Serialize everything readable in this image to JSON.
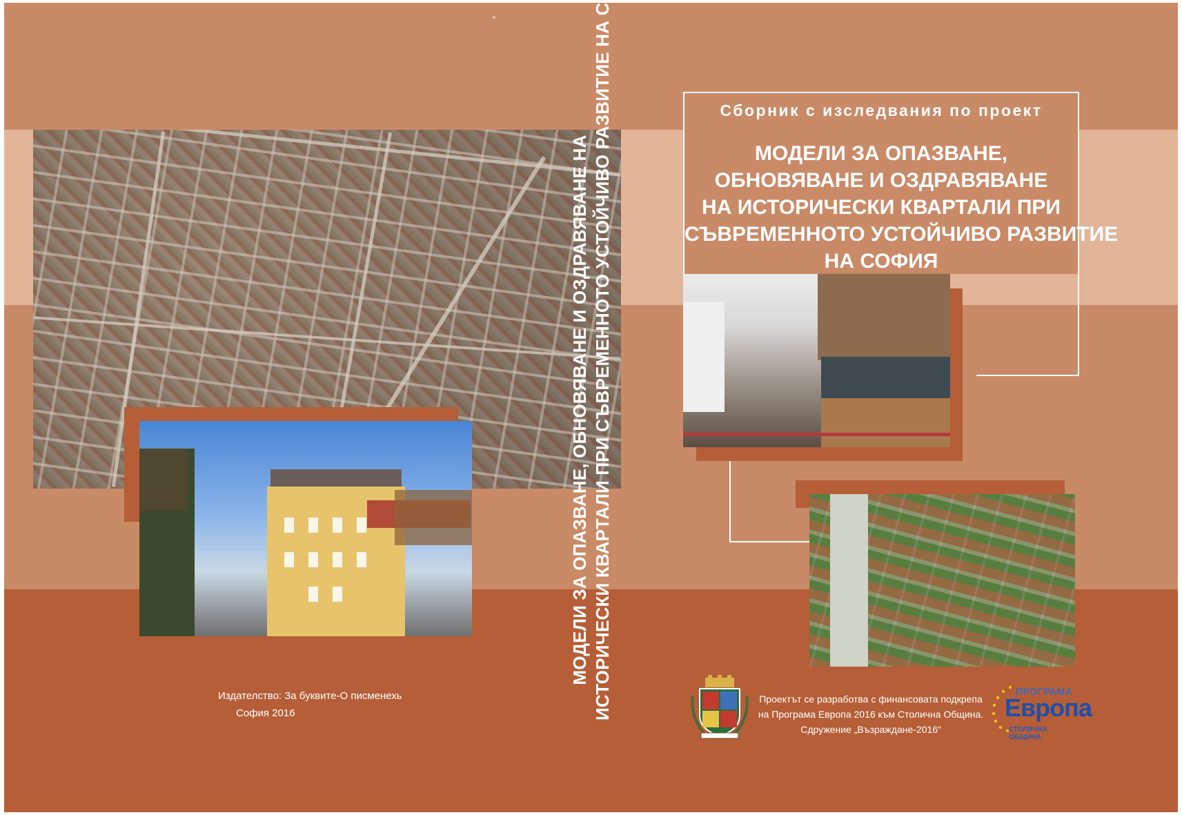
{
  "colors": {
    "light_band": "#e2b599",
    "mid_band": "#c98a67",
    "dark_band": "#b55e37",
    "text": "#ffffff",
    "euro_blue": "#1f4fa8"
  },
  "front": {
    "subtitle": "Сборник с изследвания по проект",
    "title_lines": [
      "МОДЕЛИ ЗА ОПАЗВАНЕ,",
      "ОБНОВЯВАНЕ И ОЗДРАВЯВАНЕ",
      "НА ИСТОРИЧЕСКИ КВАРТАЛИ ПРИ",
      "СЪВРЕМЕННОТО УСТОЙЧИВО РАЗВИТИЕ",
      "НА СОФИЯ"
    ],
    "funding_lines": [
      "Проектът се разработва с финансовата подкрепа",
      "на Програма Европа 2016 към Столична Община.",
      "Сдружение „Възраждане-2016“"
    ],
    "crest_motto": "РАСТЕ НО НЕ СТАРЕЕ",
    "program_logo": {
      "line1": "ПРОГРАМА",
      "line2": "Европа",
      "line3": "СТОЛИЧНА ОБЩИНА"
    }
  },
  "spine": {
    "line1": "МОДЕЛИ ЗА ОПАЗВАНЕ, ОБНОВЯВАНЕ И ОЗДРАВЯВАНЕ НА",
    "line2": "ИСТОРИЧЕСКИ КВАРТАЛИ ПРИ СЪВРЕМЕННОТО УСТОЙЧИВО РАЗВИТИЕ НА СОФИЯ"
  },
  "back": {
    "publisher": "Издателство: За буквите-О писменехь",
    "place_year": "София  2016"
  },
  "icons": [
    "sofia-crest-icon",
    "europe-program-logo-icon"
  ]
}
